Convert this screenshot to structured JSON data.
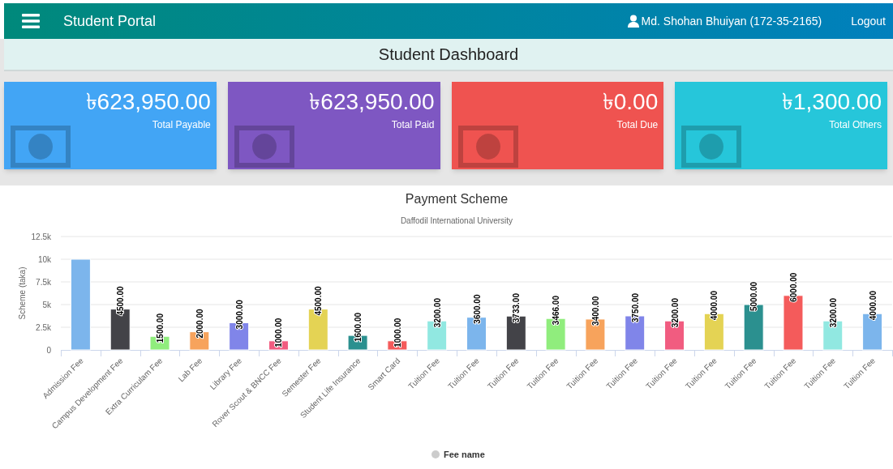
{
  "navbar": {
    "title": "Student Portal",
    "user": "Md. Shohan Bhuiyan (172-35-2165)",
    "logout": "Logout"
  },
  "header": {
    "title": "Student Dashboard"
  },
  "cards": [
    {
      "amount": "৳623,950.00",
      "label": "Total Payable",
      "color": "#42a5f5"
    },
    {
      "amount": "৳623,950.00",
      "label": "Total Paid",
      "color": "#7e57c2"
    },
    {
      "amount": "৳0.00",
      "label": "Total Due",
      "color": "#ef5350"
    },
    {
      "amount": "৳1,300.00",
      "label": "Total Others",
      "color": "#26c6da"
    }
  ],
  "chart": {
    "chart_data": {
      "type": "bar",
      "title": "Payment Scheme",
      "subtitle": "Daffodil International University",
      "ylabel": "Scheme (taka)",
      "categories": [
        "Admission Fee",
        "Campus Development Fee",
        "Extra Curriculam Fee",
        "Lab Fee",
        "Library Fee",
        "Rover Scout & BNCC Fee",
        "Semester Fee",
        "Student Life Insurance",
        "Smart Card",
        "Tuition Fee",
        "Tuition Fee",
        "Tuition Fee",
        "Tuition Fee",
        "Tuition Fee",
        "Tuition Fee",
        "Tuition Fee",
        "Tuition Fee",
        "Tuition Fee",
        "Tuition Fee",
        "Tuition Fee",
        "Tuition Fee"
      ],
      "series": [
        {
          "name": "Fee name",
          "values": [
            10000,
            4500,
            1500,
            2000,
            3000,
            1000,
            4500,
            1600,
            1000,
            3200,
            3600,
            3733,
            3466,
            3400,
            3750,
            3200,
            4000,
            5000,
            6000,
            3200,
            4000
          ]
        }
      ],
      "grid": true,
      "value_labels": [
        null,
        "4500.00",
        "1500.00",
        "2000.00",
        "3000.00",
        "1000.00",
        "4500.00",
        "1600.00",
        "1000.00",
        "3200.00",
        "3600.00",
        "3733.00",
        "3466.00",
        "3400.00",
        "3750.00",
        "3200.00",
        "4000.00",
        "5000.00",
        "6000.00",
        "3200.00",
        "4000.00"
      ],
      "ylim": [
        0,
        12500
      ],
      "yticks": [
        {
          "value": 0,
          "label": "0"
        },
        {
          "value": 2500,
          "label": "2.5k"
        },
        {
          "value": 5000,
          "label": "5k"
        },
        {
          "value": 7500,
          "label": "7.5k"
        },
        {
          "value": 10000,
          "label": "10k"
        },
        {
          "value": 12500,
          "label": "12.5k"
        }
      ]
    }
  }
}
